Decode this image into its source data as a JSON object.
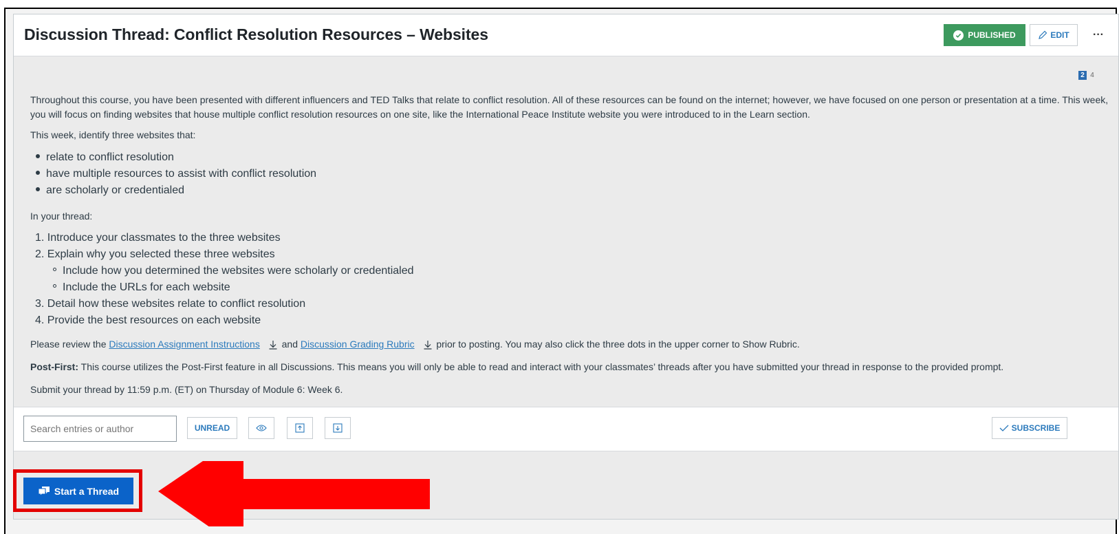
{
  "header": {
    "title": "Discussion Thread: Conflict Resolution Resources – Websites",
    "published_label": "PUBLISHED",
    "edit_label": "EDIT",
    "more_label": "···"
  },
  "badges": {
    "first": "2",
    "second": "4"
  },
  "body": {
    "intro": "Throughout this course, you have been presented with different influencers and TED Talks that relate to conflict resolution.  All of these resources can be found on the internet; however, we have focused on one person or presentation at a time. This week, you will focus on finding websites that house multiple conflict resolution resources on one site, like the International Peace Institute website you were introduced to in the Learn section.",
    "identify_heading": "This week, identify three websites that:",
    "criteria": [
      "relate to conflict resolution",
      "have multiple resources to assist with conflict resolution",
      "are scholarly or credentialed"
    ],
    "thread_heading": "In your thread:",
    "steps": [
      "1. Introduce your classmates to the three websites",
      "2. Explain why you selected these three websites",
      "3. Detail how these websites relate to conflict resolution",
      "4. Provide the best resources on each website"
    ],
    "substeps": [
      "Include how you determined the websites were scholarly or credentialed",
      "Include the URLs for each website"
    ],
    "review_prefix": "Please review the",
    "link_instructions": "Discussion Assignment Instructions",
    "review_and": "and",
    "link_rubric": "Discussion Grading Rubric",
    "review_suffix": "prior to posting.  You may also click the three dots in the upper corner to Show Rubric.",
    "postfirst_label": "Post-First:",
    "postfirst_text": " This course utilizes the Post-First feature in all Discussions. This means you will only be able to read and interact with your classmates’ threads after you have submitted your thread in response to the provided prompt.",
    "deadline": "Submit your thread by 11:59 p.m. (ET) on Thursday of Module 6: Week 6."
  },
  "toolbar": {
    "search_placeholder": "Search entries or author",
    "unread_label": "UNREAD",
    "subscribe_label": "SUBSCRIBE"
  },
  "actions": {
    "start_thread_label": "Start a Thread"
  },
  "colors": {
    "annotation_red": "#ff0000",
    "accent_blue": "#0b63c9",
    "published_green": "#3d9a5e"
  }
}
